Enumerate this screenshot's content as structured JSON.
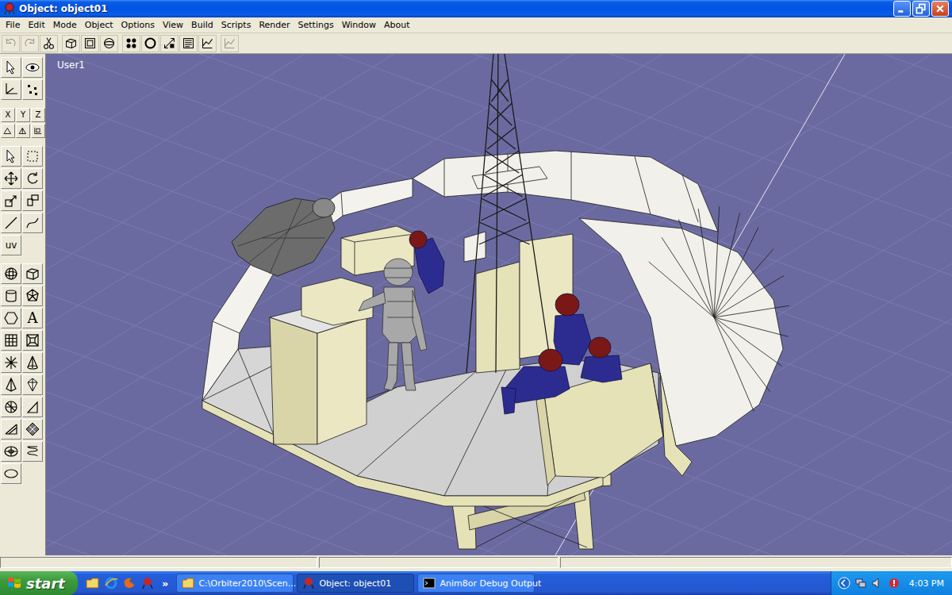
{
  "window": {
    "title": "Object: object01"
  },
  "menu": [
    "File",
    "Edit",
    "Mode",
    "Object",
    "Options",
    "View",
    "Build",
    "Scripts",
    "Render",
    "Settings",
    "Window",
    "About"
  ],
  "toolbar_buttons": [
    {
      "disabled": true
    },
    {
      "disabled": true
    },
    {
      "disabled": false
    },
    {
      "disabled": false
    },
    {
      "disabled": false
    },
    {
      "disabled": false
    },
    {
      "disabled": false
    },
    {
      "disabled": false
    },
    {
      "disabled": false
    },
    {
      "disabled": false
    },
    {
      "disabled": false
    },
    {
      "disabled": true
    }
  ],
  "tools": {
    "axes": [
      "X",
      "Y",
      "Z"
    ],
    "uv": "uv",
    "text": "A"
  },
  "viewport": {
    "label": "User1"
  },
  "taskbar": {
    "start": "start",
    "overflow": "»",
    "tasks": [
      {
        "label": "C:\\Orbiter2010\\Scen...",
        "selected": false
      },
      {
        "label": "Object: object01",
        "selected": true
      },
      {
        "label": "Anim8or Debug Output",
        "selected": false
      }
    ],
    "clock": "4:03 PM"
  }
}
